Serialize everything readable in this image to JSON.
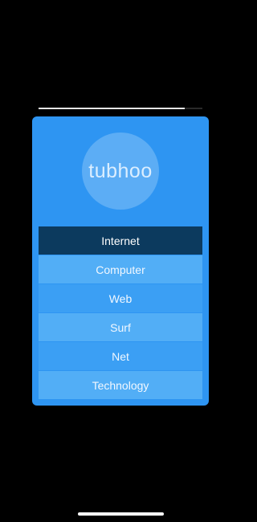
{
  "progress": {
    "fraction": 0.89
  },
  "card": {
    "avatar_text": "tubhoo"
  },
  "menu": {
    "items": [
      {
        "label": "Internet",
        "state": "selected"
      },
      {
        "label": "Computer",
        "state": "light"
      },
      {
        "label": "Web",
        "state": "mid"
      },
      {
        "label": "Surf",
        "state": "light"
      },
      {
        "label": "Net",
        "state": "mid"
      },
      {
        "label": "Technology",
        "state": "light"
      }
    ]
  },
  "colors": {
    "background": "#000000",
    "card": "#2e95f2",
    "selected_item": "#0c3a5e",
    "item_light": "#52aef6",
    "item_mid": "#3b9ff4"
  }
}
